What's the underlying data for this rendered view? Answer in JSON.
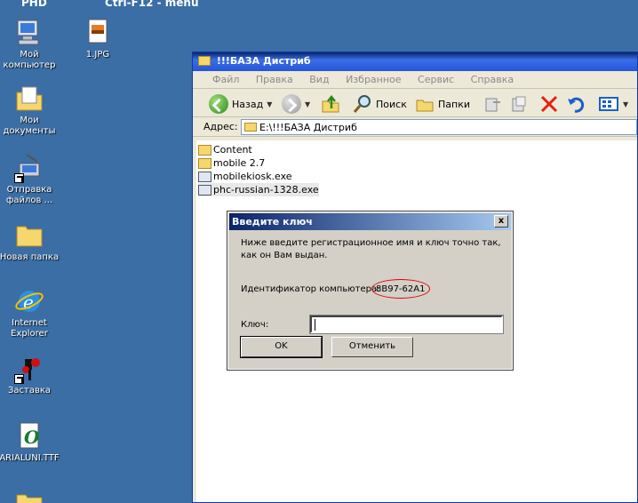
{
  "top": {
    "left_text": "PHD",
    "center_text": "Ctrl-F12 - menu"
  },
  "desktop": {
    "icons": [
      {
        "label": "Мой компьютер",
        "icon": "my-computer-icon"
      },
      {
        "label": "1.JPG",
        "icon": "image-file-icon"
      },
      {
        "label": "Мои документы",
        "icon": "my-documents-icon"
      },
      {
        "label": "Отправка файлов ...",
        "icon": "send-files-icon"
      },
      {
        "label": "Новая папка",
        "icon": "folder-icon"
      },
      {
        "label": "Internet Explorer",
        "icon": "internet-explorer-icon"
      },
      {
        "label": "Заставка",
        "icon": "screensaver-icon"
      },
      {
        "label": "ARIALUNI.TTF",
        "icon": "font-file-icon"
      }
    ]
  },
  "explorer": {
    "title": "!!!БАЗА Дистриб",
    "menu": [
      "Файл",
      "Правка",
      "Вид",
      "Избранное",
      "Сервис",
      "Справка"
    ],
    "toolbar": {
      "back": "Назад",
      "search": "Поиск",
      "folders": "Папки"
    },
    "address_label": "Адрес:",
    "address_value": "E:\\!!!БАЗА Дистриб",
    "files": [
      {
        "name": "Content",
        "type": "folder"
      },
      {
        "name": "mobile 2.7",
        "type": "folder"
      },
      {
        "name": "mobilekiosk.exe",
        "type": "exe"
      },
      {
        "name": "phc-russian-1328.exe",
        "type": "exe"
      }
    ]
  },
  "dialog": {
    "title": "Введите ключ",
    "instruction": "Ниже введите регистрационное имя и ключ точно так, как он Вам выдан.",
    "id_label": "Идентификатор компьютера:",
    "id_value": "8B97-62A1",
    "key_label": "Ключ:",
    "key_value": "",
    "ok_label": "OK",
    "cancel_label": "Отменить",
    "close_glyph": "x"
  },
  "colors": {
    "desktop": "#3a6ea5",
    "annotation": "#e00000"
  }
}
